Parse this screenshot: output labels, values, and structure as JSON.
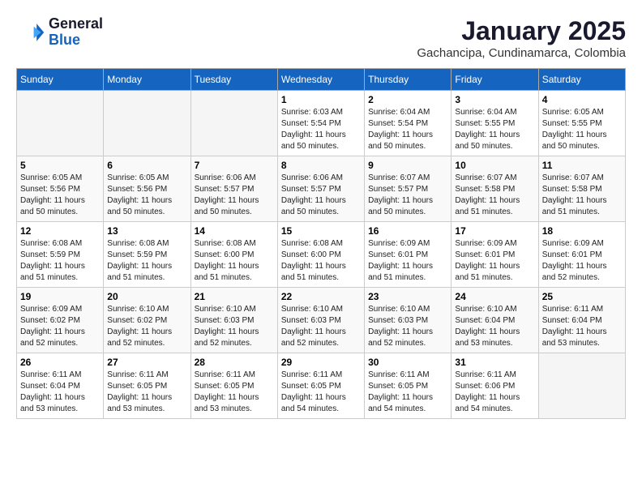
{
  "header": {
    "logo_general": "General",
    "logo_blue": "Blue",
    "month_title": "January 2025",
    "location": "Gachancipa, Cundinamarca, Colombia"
  },
  "days_of_week": [
    "Sunday",
    "Monday",
    "Tuesday",
    "Wednesday",
    "Thursday",
    "Friday",
    "Saturday"
  ],
  "weeks": [
    [
      {
        "day": "",
        "sunrise": "",
        "sunset": "",
        "daylight": ""
      },
      {
        "day": "",
        "sunrise": "",
        "sunset": "",
        "daylight": ""
      },
      {
        "day": "",
        "sunrise": "",
        "sunset": "",
        "daylight": ""
      },
      {
        "day": "1",
        "sunrise": "Sunrise: 6:03 AM",
        "sunset": "Sunset: 5:54 PM",
        "daylight": "Daylight: 11 hours and 50 minutes."
      },
      {
        "day": "2",
        "sunrise": "Sunrise: 6:04 AM",
        "sunset": "Sunset: 5:54 PM",
        "daylight": "Daylight: 11 hours and 50 minutes."
      },
      {
        "day": "3",
        "sunrise": "Sunrise: 6:04 AM",
        "sunset": "Sunset: 5:55 PM",
        "daylight": "Daylight: 11 hours and 50 minutes."
      },
      {
        "day": "4",
        "sunrise": "Sunrise: 6:05 AM",
        "sunset": "Sunset: 5:55 PM",
        "daylight": "Daylight: 11 hours and 50 minutes."
      }
    ],
    [
      {
        "day": "5",
        "sunrise": "Sunrise: 6:05 AM",
        "sunset": "Sunset: 5:56 PM",
        "daylight": "Daylight: 11 hours and 50 minutes."
      },
      {
        "day": "6",
        "sunrise": "Sunrise: 6:05 AM",
        "sunset": "Sunset: 5:56 PM",
        "daylight": "Daylight: 11 hours and 50 minutes."
      },
      {
        "day": "7",
        "sunrise": "Sunrise: 6:06 AM",
        "sunset": "Sunset: 5:57 PM",
        "daylight": "Daylight: 11 hours and 50 minutes."
      },
      {
        "day": "8",
        "sunrise": "Sunrise: 6:06 AM",
        "sunset": "Sunset: 5:57 PM",
        "daylight": "Daylight: 11 hours and 50 minutes."
      },
      {
        "day": "9",
        "sunrise": "Sunrise: 6:07 AM",
        "sunset": "Sunset: 5:57 PM",
        "daylight": "Daylight: 11 hours and 50 minutes."
      },
      {
        "day": "10",
        "sunrise": "Sunrise: 6:07 AM",
        "sunset": "Sunset: 5:58 PM",
        "daylight": "Daylight: 11 hours and 51 minutes."
      },
      {
        "day": "11",
        "sunrise": "Sunrise: 6:07 AM",
        "sunset": "Sunset: 5:58 PM",
        "daylight": "Daylight: 11 hours and 51 minutes."
      }
    ],
    [
      {
        "day": "12",
        "sunrise": "Sunrise: 6:08 AM",
        "sunset": "Sunset: 5:59 PM",
        "daylight": "Daylight: 11 hours and 51 minutes."
      },
      {
        "day": "13",
        "sunrise": "Sunrise: 6:08 AM",
        "sunset": "Sunset: 5:59 PM",
        "daylight": "Daylight: 11 hours and 51 minutes."
      },
      {
        "day": "14",
        "sunrise": "Sunrise: 6:08 AM",
        "sunset": "Sunset: 6:00 PM",
        "daylight": "Daylight: 11 hours and 51 minutes."
      },
      {
        "day": "15",
        "sunrise": "Sunrise: 6:08 AM",
        "sunset": "Sunset: 6:00 PM",
        "daylight": "Daylight: 11 hours and 51 minutes."
      },
      {
        "day": "16",
        "sunrise": "Sunrise: 6:09 AM",
        "sunset": "Sunset: 6:01 PM",
        "daylight": "Daylight: 11 hours and 51 minutes."
      },
      {
        "day": "17",
        "sunrise": "Sunrise: 6:09 AM",
        "sunset": "Sunset: 6:01 PM",
        "daylight": "Daylight: 11 hours and 51 minutes."
      },
      {
        "day": "18",
        "sunrise": "Sunrise: 6:09 AM",
        "sunset": "Sunset: 6:01 PM",
        "daylight": "Daylight: 11 hours and 52 minutes."
      }
    ],
    [
      {
        "day": "19",
        "sunrise": "Sunrise: 6:09 AM",
        "sunset": "Sunset: 6:02 PM",
        "daylight": "Daylight: 11 hours and 52 minutes."
      },
      {
        "day": "20",
        "sunrise": "Sunrise: 6:10 AM",
        "sunset": "Sunset: 6:02 PM",
        "daylight": "Daylight: 11 hours and 52 minutes."
      },
      {
        "day": "21",
        "sunrise": "Sunrise: 6:10 AM",
        "sunset": "Sunset: 6:03 PM",
        "daylight": "Daylight: 11 hours and 52 minutes."
      },
      {
        "day": "22",
        "sunrise": "Sunrise: 6:10 AM",
        "sunset": "Sunset: 6:03 PM",
        "daylight": "Daylight: 11 hours and 52 minutes."
      },
      {
        "day": "23",
        "sunrise": "Sunrise: 6:10 AM",
        "sunset": "Sunset: 6:03 PM",
        "daylight": "Daylight: 11 hours and 52 minutes."
      },
      {
        "day": "24",
        "sunrise": "Sunrise: 6:10 AM",
        "sunset": "Sunset: 6:04 PM",
        "daylight": "Daylight: 11 hours and 53 minutes."
      },
      {
        "day": "25",
        "sunrise": "Sunrise: 6:11 AM",
        "sunset": "Sunset: 6:04 PM",
        "daylight": "Daylight: 11 hours and 53 minutes."
      }
    ],
    [
      {
        "day": "26",
        "sunrise": "Sunrise: 6:11 AM",
        "sunset": "Sunset: 6:04 PM",
        "daylight": "Daylight: 11 hours and 53 minutes."
      },
      {
        "day": "27",
        "sunrise": "Sunrise: 6:11 AM",
        "sunset": "Sunset: 6:05 PM",
        "daylight": "Daylight: 11 hours and 53 minutes."
      },
      {
        "day": "28",
        "sunrise": "Sunrise: 6:11 AM",
        "sunset": "Sunset: 6:05 PM",
        "daylight": "Daylight: 11 hours and 53 minutes."
      },
      {
        "day": "29",
        "sunrise": "Sunrise: 6:11 AM",
        "sunset": "Sunset: 6:05 PM",
        "daylight": "Daylight: 11 hours and 54 minutes."
      },
      {
        "day": "30",
        "sunrise": "Sunrise: 6:11 AM",
        "sunset": "Sunset: 6:05 PM",
        "daylight": "Daylight: 11 hours and 54 minutes."
      },
      {
        "day": "31",
        "sunrise": "Sunrise: 6:11 AM",
        "sunset": "Sunset: 6:06 PM",
        "daylight": "Daylight: 11 hours and 54 minutes."
      },
      {
        "day": "",
        "sunrise": "",
        "sunset": "",
        "daylight": ""
      }
    ]
  ]
}
